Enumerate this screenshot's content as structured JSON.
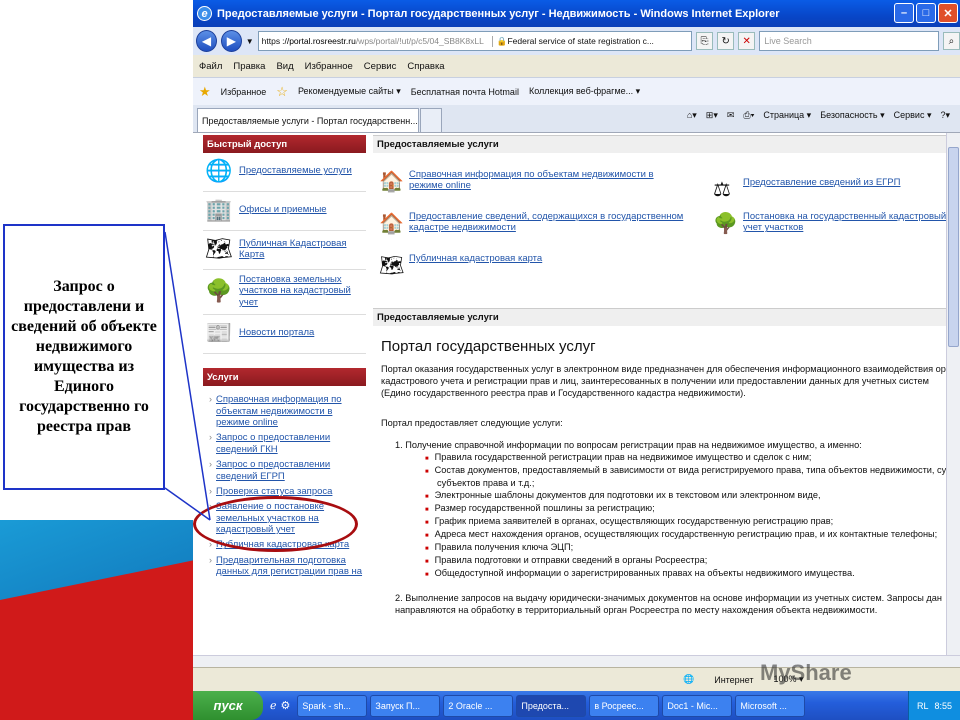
{
  "callout": "Запрос о предоставлени и сведений об объекте недвижимого имущества из Единого государственно го реестра прав",
  "window": {
    "title": "Предоставляемые услуги - Портал государственных услуг - Недвижимость - Windows Internet Explorer"
  },
  "address": {
    "scheme": "https",
    "host": "://portal.rosreestr.ru",
    "path": "/wps/portal/!ut/p/c5/04_SB8K8xLL",
    "cert": "Federal service of state registration c..."
  },
  "search_placeholder": "Live Search",
  "menu": [
    "Файл",
    "Правка",
    "Вид",
    "Избранное",
    "Сервис",
    "Справка"
  ],
  "favbar": {
    "favorites": "Избранное",
    "items": [
      "Рекомендуемые сайты ▾",
      "Бесплатная почта Hotmail",
      "Коллекция веб-фрагме... ▾"
    ]
  },
  "tab_label": "Предоставляемые услуги - Портал государственн...",
  "cmdbar": [
    "Страница ▾",
    "Безопасность ▾",
    "Сервис ▾"
  ],
  "left": {
    "quick_header": "Быстрый доступ",
    "quick": [
      "Предоставляемые услуги",
      "Офисы и приемные",
      "Публичная Кадастровая Карта",
      "Постановка земельных участков на кадастровый учет",
      "Новости портала"
    ],
    "services_header": "Услуги",
    "services": [
      "Справочная информация по объектам недвижимости в режиме online",
      "Запрос о предоставлении сведений ГКН",
      "Запрос о предоставлении сведений ЕГРП",
      "Проверка статуса запроса",
      "Заявление о постановке земельных участков на кадастровый учет",
      "Публичная кадастровая карта",
      "Предварительная подготовка данных для регистрации прав на"
    ]
  },
  "right": {
    "header1": "Предоставляемые услуги",
    "links": [
      "Справочная информация по объектам недвижимости в режиме online",
      "Предоставление сведений, содержащихся в государственном кадастре недвижимости",
      "Публичная кадастровая карта",
      "Предоставление сведений из ЕГРП",
      "Постановка на государственный кадастровый учет участков"
    ],
    "header2": "Предоставляемые услуги",
    "portal_title": "Портал государственных услуг",
    "p1": "Портал оказания государственных услуг в электронном виде предназначен для обеспечения информационного взаимодействия ор кадастрового учета и регистрации прав и лиц, заинтересованных в получении или предоставлении данных для учетных систем (Едино государственного реестра прав и Государственного кадастра недвижимости).",
    "p2": "Портал предоставляет следующие услуги:",
    "item1": "1.   Получение справочной информации по вопросам регистрации прав на недвижимое имущество, а именно:",
    "bullets": [
      "Правила государственной регистрации прав на недвижимое имущество и сделок с ним;",
      "Состав документов, предоставляемый в зависимости от вида регистрируемого права, типа объектов недвижимости, су субъектов права и т.д.;",
      "Электронные шаблоны документов для подготовки их в текстовом или электронном виде,",
      "Размер государственной пошлины за регистрацию;",
      "График приема заявителей в органах, осуществляющих государственную регистрацию прав;",
      "Адреса мест нахождения органов, осуществляющих государственную регистрацию прав, и их контактные телефоны;",
      "Правила получения ключа ЭЦП;",
      "Правила подготовки и отправки сведений в органы Росреестра;",
      "Общедоступной информации о зарегистрированных правах на объекты недвижимого имущества."
    ],
    "item2": "2.   Выполнение запросов на выдачу юридически-значимых документов на основе информации из учетных систем. Запросы дан направляются на обработку в территориальный орган Росреестра по месту нахождения объекта недвижимости."
  },
  "status": {
    "zone": "Интернет",
    "zoom": "100% ▾"
  },
  "taskbar": {
    "start": "пуск",
    "tasks": [
      "Spark - sh...",
      "Запуск П...",
      "2 Oracle ...",
      "Предоста...",
      "в Росреес...",
      "Doc1 - Mic...",
      "Microsoft ..."
    ],
    "lang": "RL",
    "time": "8:55"
  },
  "watermark": "MyShare"
}
